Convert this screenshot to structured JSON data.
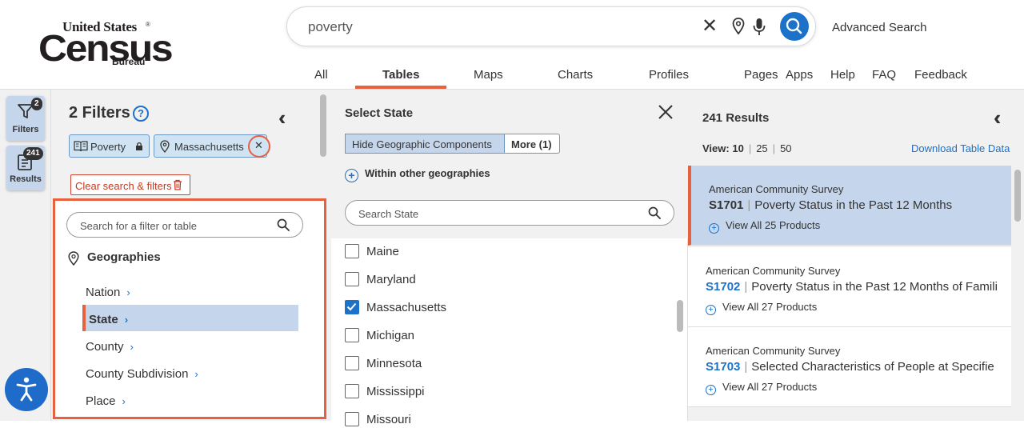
{
  "header": {
    "logo": {
      "line1": "United States",
      "line2": "Census",
      "line3": "Bureau",
      "reg": "®"
    },
    "search": {
      "query": "poverty"
    },
    "advanced_search": "Advanced Search",
    "tabs": [
      "All",
      "Tables",
      "Maps",
      "Charts",
      "Profiles",
      "Pages",
      "Apps",
      "Help",
      "FAQ",
      "Feedback"
    ],
    "active_tab": "Tables",
    "accent_color": "#e8613f",
    "brand_color": "#1c71c9"
  },
  "rail": {
    "filters": {
      "label": "Filters",
      "badge": "2"
    },
    "results": {
      "label": "Results",
      "badge": "241"
    }
  },
  "filters": {
    "title": "2 Filters",
    "help": "?",
    "chips": [
      {
        "label": "Poverty"
      },
      {
        "label": "Massachusetts"
      }
    ],
    "clear_label": "Clear search & filters",
    "search_placeholder": "Search for a filter or table",
    "geographies_label": "Geographies",
    "geo_items": [
      "Nation",
      "State",
      "County",
      "County Subdivision",
      "Place"
    ],
    "active_geo": "State"
  },
  "state_panel": {
    "title": "Select State",
    "hide_label": "Hide Geographic Components",
    "more_label": "More (1)",
    "within_label": "Within other geographies",
    "search_placeholder": "Search State",
    "states": [
      {
        "name": "Maine",
        "checked": false
      },
      {
        "name": "Maryland",
        "checked": false
      },
      {
        "name": "Massachusetts",
        "checked": true
      },
      {
        "name": "Michigan",
        "checked": false
      },
      {
        "name": "Minnesota",
        "checked": false
      },
      {
        "name": "Mississippi",
        "checked": false
      },
      {
        "name": "Missouri",
        "checked": false
      }
    ]
  },
  "results": {
    "count": "241 Results",
    "view_label": "View:",
    "view_options": [
      "10",
      "25",
      "50"
    ],
    "download": "Download Table Data",
    "items": [
      {
        "source": "American Community Survey",
        "code": "S1701",
        "title": "Poverty Status in the Past 12 Months",
        "products": "View All 25 Products"
      },
      {
        "source": "American Community Survey",
        "code": "S1702",
        "title": "Poverty Status in the Past 12 Months of Famili",
        "products": "View All 27 Products"
      },
      {
        "source": "American Community Survey",
        "code": "S1703",
        "title": "Selected Characteristics of People at Specifie",
        "products": "View All 27 Products"
      }
    ]
  }
}
